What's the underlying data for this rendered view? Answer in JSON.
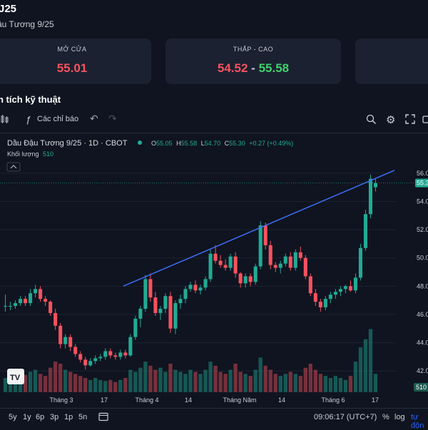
{
  "header": {
    "title": "J25",
    "subtitle": "ậu Tương 9/25"
  },
  "stats": [
    {
      "label": "MỞ CỬA",
      "value": "55.01"
    },
    {
      "label": "THẤP - CAO",
      "low": "54.52",
      "sep": "-",
      "high": "55.58"
    }
  ],
  "section_title": "n tích kỹ thuật",
  "toolbar": {
    "indicators_label": "Các chỉ báo",
    "fx_icon": "ƒ"
  },
  "chart": {
    "symbol_line": "Dầu Đậu Tương 9/25 · 1D · CBOT",
    "ohlc": {
      "o_label": "O",
      "o": "55.05",
      "h_label": "H",
      "h": "55.58",
      "l_label": "L",
      "l": "54.70",
      "c_label": "C",
      "c": "55.30",
      "chg": "+0.27 (+0.49%)"
    },
    "volume_label": "Khối lượng",
    "volume_value": "510",
    "price_badge": "55.3",
    "volume_badge": "510",
    "y_ticks": [
      "56.0",
      "54.0",
      "52.0",
      "50.0",
      "48.0",
      "46.0",
      "44.0",
      "42.0"
    ],
    "x_ticks": [
      "Tháng 3",
      "17",
      "Tháng 4",
      "14",
      "Tháng Năm",
      "14",
      "Tháng 6",
      "17"
    ],
    "colors": {
      "up": "#22ab94",
      "down": "#f7525f",
      "trendline": "#3d6ef5"
    }
  },
  "chart_data": {
    "type": "candlestick",
    "title": "Dầu Đậu Tương 9/25 · 1D · CBOT",
    "ylim": [
      41,
      57
    ],
    "trendline": [
      {
        "x": "Tháng 4",
        "y": 48.0
      },
      {
        "x": "17",
        "y": 56.2
      }
    ],
    "candles": [
      [
        46.6,
        47.4,
        46.2,
        46.6
      ],
      [
        46.6,
        46.9,
        46.3,
        46.6
      ],
      [
        46.6,
        47.0,
        46.4,
        46.8
      ],
      [
        46.8,
        47.3,
        46.6,
        47.1
      ],
      [
        47.1,
        47.3,
        46.6,
        46.8
      ],
      [
        46.8,
        47.8,
        46.6,
        47.5
      ],
      [
        47.5,
        48.1,
        47.2,
        47.8
      ],
      [
        47.8,
        48.0,
        46.9,
        47.1
      ],
      [
        47.1,
        47.3,
        46.6,
        46.9
      ],
      [
        46.9,
        47.0,
        45.9,
        46.1
      ],
      [
        46.1,
        46.4,
        44.9,
        45.2
      ],
      [
        45.2,
        45.4,
        43.6,
        43.9
      ],
      [
        43.9,
        44.6,
        43.6,
        44.4
      ],
      [
        44.4,
        44.6,
        43.4,
        43.7
      ],
      [
        43.7,
        43.9,
        43.0,
        43.2
      ],
      [
        43.2,
        43.4,
        42.6,
        42.8
      ],
      [
        42.8,
        43.0,
        42.1,
        42.4
      ],
      [
        42.4,
        42.9,
        42.3,
        42.7
      ],
      [
        42.7,
        43.1,
        42.5,
        42.9
      ],
      [
        42.9,
        43.2,
        42.7,
        43.0
      ],
      [
        43.0,
        43.6,
        42.8,
        43.4
      ],
      [
        43.4,
        43.6,
        42.9,
        43.1
      ],
      [
        43.1,
        43.3,
        42.8,
        43.0
      ],
      [
        43.0,
        43.5,
        42.8,
        43.3
      ],
      [
        43.3,
        43.5,
        42.9,
        43.1
      ],
      [
        43.1,
        44.6,
        43.0,
        44.4
      ],
      [
        44.4,
        45.9,
        44.2,
        45.7
      ],
      [
        45.7,
        46.6,
        45.1,
        46.4
      ],
      [
        46.4,
        48.8,
        46.2,
        48.5
      ],
      [
        48.5,
        48.9,
        46.9,
        47.2
      ],
      [
        47.2,
        47.6,
        45.9,
        46.1
      ],
      [
        46.1,
        46.6,
        45.6,
        46.4
      ],
      [
        46.4,
        47.5,
        46.1,
        47.3
      ],
      [
        47.3,
        47.6,
        44.7,
        45.0
      ],
      [
        45.0,
        47.0,
        44.6,
        46.8
      ],
      [
        46.8,
        47.4,
        46.4,
        47.1
      ],
      [
        47.1,
        48.0,
        46.8,
        47.8
      ],
      [
        47.8,
        48.3,
        47.6,
        48.1
      ],
      [
        48.1,
        48.4,
        47.5,
        47.7
      ],
      [
        47.7,
        48.1,
        47.4,
        47.9
      ],
      [
        47.9,
        48.7,
        47.7,
        48.5
      ],
      [
        48.5,
        50.6,
        48.3,
        50.3
      ],
      [
        50.3,
        50.9,
        49.6,
        49.8
      ],
      [
        49.8,
        50.2,
        49.3,
        49.5
      ],
      [
        49.5,
        49.9,
        49.1,
        49.3
      ],
      [
        49.3,
        50.3,
        49.1,
        50.1
      ],
      [
        50.1,
        50.4,
        48.6,
        48.9
      ],
      [
        48.9,
        49.0,
        47.9,
        48.2
      ],
      [
        48.2,
        48.9,
        47.9,
        48.7
      ],
      [
        48.7,
        48.9,
        48.0,
        48.3
      ],
      [
        48.3,
        49.6,
        48.1,
        49.4
      ],
      [
        49.4,
        52.6,
        49.2,
        52.3
      ],
      [
        52.3,
        52.5,
        50.6,
        50.9
      ],
      [
        50.9,
        51.2,
        49.2,
        49.5
      ],
      [
        49.5,
        49.7,
        49.0,
        49.3
      ],
      [
        49.3,
        49.8,
        48.9,
        49.6
      ],
      [
        49.6,
        50.3,
        49.4,
        50.1
      ],
      [
        50.1,
        50.4,
        49.1,
        49.3
      ],
      [
        49.3,
        50.6,
        49.1,
        50.4
      ],
      [
        50.4,
        50.8,
        49.8,
        50.0
      ],
      [
        50.0,
        50.2,
        48.5,
        48.7
      ],
      [
        48.7,
        48.9,
        47.3,
        47.5
      ],
      [
        47.5,
        47.8,
        46.6,
        46.9
      ],
      [
        46.9,
        47.1,
        46.2,
        46.5
      ],
      [
        46.5,
        47.3,
        46.3,
        47.1
      ],
      [
        47.1,
        47.6,
        46.8,
        47.4
      ],
      [
        47.4,
        47.8,
        47.1,
        47.6
      ],
      [
        47.6,
        48.0,
        47.3,
        47.8
      ],
      [
        47.8,
        48.1,
        47.5,
        48.0
      ],
      [
        48.0,
        48.4,
        47.6,
        47.7
      ],
      [
        47.7,
        48.9,
        47.5,
        48.6
      ],
      [
        48.6,
        51.0,
        48.4,
        50.7
      ],
      [
        50.7,
        53.4,
        50.5,
        53.1
      ],
      [
        53.1,
        55.9,
        52.8,
        55.6
      ],
      [
        55.0,
        55.6,
        54.7,
        55.3
      ]
    ],
    "volume": [
      14,
      16,
      18,
      15,
      17,
      20,
      22,
      18,
      16,
      24,
      30,
      28,
      22,
      20,
      18,
      16,
      14,
      12,
      14,
      12,
      11,
      12,
      10,
      12,
      14,
      22,
      20,
      24,
      30,
      26,
      22,
      24,
      20,
      28,
      22,
      20,
      18,
      22,
      20,
      18,
      22,
      30,
      26,
      20,
      18,
      22,
      28,
      20,
      18,
      16,
      22,
      34,
      26,
      22,
      18,
      16,
      18,
      20,
      18,
      16,
      24,
      28,
      22,
      18,
      16,
      14,
      16,
      14,
      12,
      16,
      30,
      44,
      52,
      62,
      18
    ],
    "volume_max": 70
  }
}
